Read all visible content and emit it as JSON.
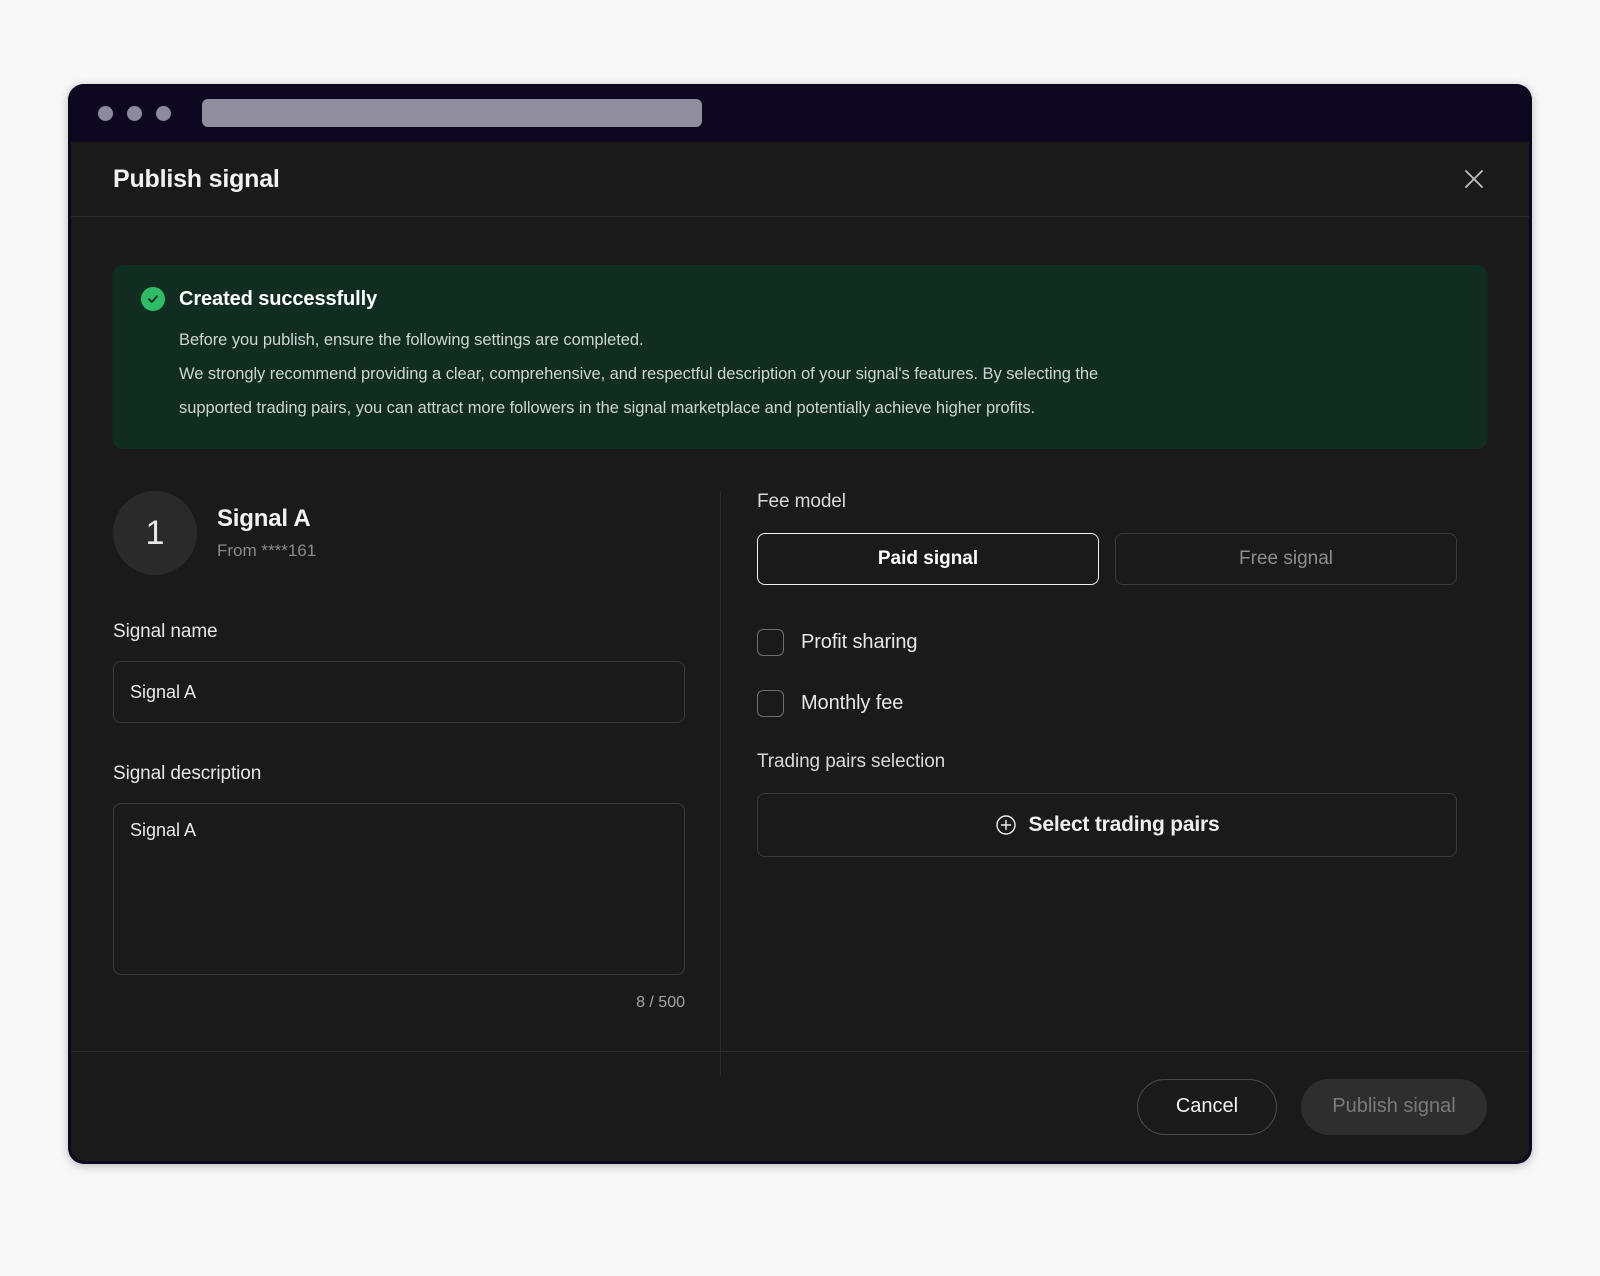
{
  "browser": {
    "traffic_lights": [
      "close",
      "minimize",
      "maximize"
    ],
    "address_bar_value": ""
  },
  "modal": {
    "title": "Publish signal",
    "close_icon": "close-icon"
  },
  "banner": {
    "icon": "check-circle-icon",
    "title": "Created successfully",
    "lines": [
      "Before you publish, ensure the following settings are completed.",
      "We strongly recommend providing a clear, comprehensive, and respectful description of your signal's features. By selecting the",
      "supported trading pairs, you can attract more followers in the signal marketplace and potentially achieve higher profits."
    ],
    "background_color": "#0f2e21",
    "accent_color": "#2ebd66"
  },
  "signal": {
    "badge_number": "1",
    "name": "Signal A",
    "from": "From ****161"
  },
  "form": {
    "name_label": "Signal name",
    "name_value": "Signal A",
    "name_placeholder": "Signal name",
    "description_label": "Signal description",
    "description_value": "Signal A",
    "description_placeholder": "Signal description",
    "counter": "8 / 500"
  },
  "fee": {
    "label": "Fee model",
    "options": [
      {
        "label": "Paid signal",
        "selected": true
      },
      {
        "label": "Free signal",
        "selected": false
      }
    ],
    "checkboxes": [
      {
        "label": "Profit sharing",
        "checked": false
      },
      {
        "label": "Monthly fee",
        "checked": false
      }
    ]
  },
  "pairs": {
    "label": "Trading pairs selection",
    "button_label": "Select trading pairs",
    "button_icon": "plus-circle-icon"
  },
  "footer": {
    "cancel_label": "Cancel",
    "publish_label": "Publish signal",
    "publish_disabled": true
  }
}
